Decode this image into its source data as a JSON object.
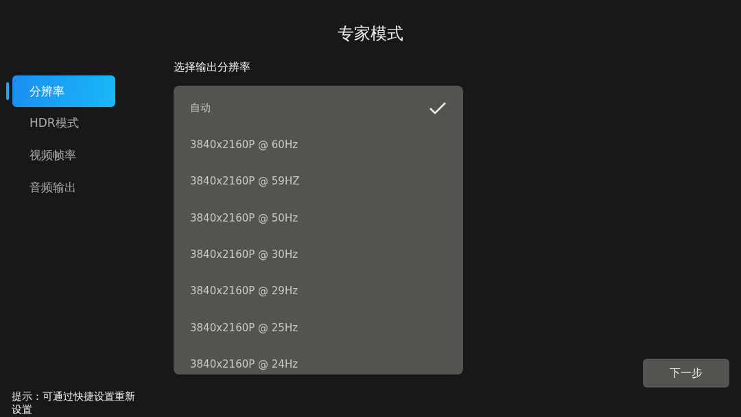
{
  "title": "专家模式",
  "sidebar": {
    "items": [
      {
        "label": "分辨率",
        "selected": true
      },
      {
        "label": "HDR模式",
        "selected": false
      },
      {
        "label": "视频帧率",
        "selected": false
      },
      {
        "label": "音频输出",
        "selected": false
      }
    ]
  },
  "section_label": "选择输出分辨率",
  "options": [
    {
      "label": "自动",
      "checked": true
    },
    {
      "label": "3840x2160P @ 60Hz",
      "checked": false
    },
    {
      "label": "3840x2160P @ 59HZ",
      "checked": false
    },
    {
      "label": "3840x2160P @ 50Hz",
      "checked": false
    },
    {
      "label": "3840x2160P @ 30Hz",
      "checked": false
    },
    {
      "label": "3840x2160P @ 29Hz",
      "checked": false
    },
    {
      "label": "3840x2160P @ 25Hz",
      "checked": false
    },
    {
      "label": "3840x2160P @ 24Hz",
      "checked": false
    }
  ],
  "hint": "提示：可通过快捷设置重新设置",
  "next_button": "下一步"
}
